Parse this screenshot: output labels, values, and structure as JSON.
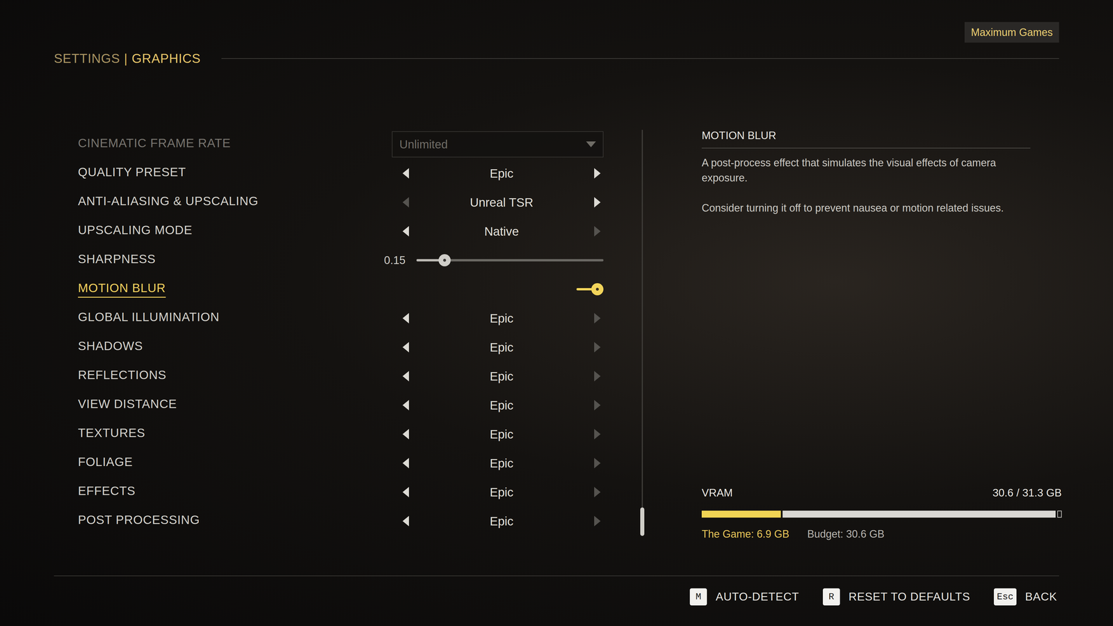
{
  "header": {
    "section": "SETTINGS",
    "separator": "|",
    "page": "GRAPHICS"
  },
  "badge": "Maximum Games",
  "rows": [
    {
      "kind": "dropdown",
      "label": "CINEMATIC FRAME RATE",
      "value": "Unlimited",
      "disabled": true,
      "selected": false
    },
    {
      "kind": "selector",
      "label": "QUALITY PRESET",
      "value": "Epic",
      "left_enabled": true,
      "right_enabled": true,
      "disabled": false,
      "selected": false
    },
    {
      "kind": "selector",
      "label": "ANTI-ALIASING & UPSCALING",
      "value": "Unreal TSR",
      "left_enabled": false,
      "right_enabled": true,
      "disabled": false,
      "selected": false
    },
    {
      "kind": "selector",
      "label": "UPSCALING MODE",
      "value": "Native",
      "left_enabled": true,
      "right_enabled": false,
      "disabled": false,
      "selected": false
    },
    {
      "kind": "slider",
      "label": "SHARPNESS",
      "reading": "0.15",
      "level": 0.15,
      "disabled": false,
      "selected": false
    },
    {
      "kind": "toggle",
      "label": "MOTION BLUR",
      "on": true,
      "disabled": false,
      "selected": true
    },
    {
      "kind": "selector",
      "label": "GLOBAL ILLUMINATION",
      "value": "Epic",
      "left_enabled": true,
      "right_enabled": false,
      "disabled": false,
      "selected": false
    },
    {
      "kind": "selector",
      "label": "SHADOWS",
      "value": "Epic",
      "left_enabled": true,
      "right_enabled": false,
      "disabled": false,
      "selected": false
    },
    {
      "kind": "selector",
      "label": "REFLECTIONS",
      "value": "Epic",
      "left_enabled": true,
      "right_enabled": false,
      "disabled": false,
      "selected": false
    },
    {
      "kind": "selector",
      "label": "VIEW DISTANCE",
      "value": "Epic",
      "left_enabled": true,
      "right_enabled": false,
      "disabled": false,
      "selected": false
    },
    {
      "kind": "selector",
      "label": "TEXTURES",
      "value": "Epic",
      "left_enabled": true,
      "right_enabled": false,
      "disabled": false,
      "selected": false
    },
    {
      "kind": "selector",
      "label": "FOLIAGE",
      "value": "Epic",
      "left_enabled": true,
      "right_enabled": false,
      "disabled": false,
      "selected": false
    },
    {
      "kind": "selector",
      "label": "EFFECTS",
      "value": "Epic",
      "left_enabled": true,
      "right_enabled": false,
      "disabled": false,
      "selected": false
    },
    {
      "kind": "selector",
      "label": "POST PROCESSING",
      "value": "Epic",
      "left_enabled": true,
      "right_enabled": false,
      "disabled": false,
      "selected": false
    }
  ],
  "scrollbar": {
    "position": 1,
    "thumb_share": 0.07
  },
  "description": {
    "title": "MOTION BLUR",
    "paragraphs": [
      "A post-process effect that simulates the visual effects of camera exposure.",
      "Consider turning it off to prevent nausea or motion related issues."
    ]
  },
  "vram": {
    "label": "VRAM",
    "reading": "30.6 / 31.3 GB",
    "game_level": 0.22,
    "budget_level": 0.978,
    "game_text": "The Game: 6.9 GB",
    "budget_text": "Budget: 30.6 GB"
  },
  "footer": [
    {
      "key": "M",
      "label": "AUTO-DETECT"
    },
    {
      "key": "R",
      "label": "RESET TO DEFAULTS"
    },
    {
      "key": "Esc",
      "label": "BACK"
    }
  ]
}
